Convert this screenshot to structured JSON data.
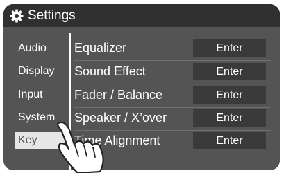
{
  "header": {
    "title": "Settings",
    "icon": "gear-icon"
  },
  "sidebar": {
    "items": [
      {
        "label": "Audio"
      },
      {
        "label": "Display"
      },
      {
        "label": "Input"
      },
      {
        "label": "System"
      },
      {
        "label": "Key",
        "selected": true
      }
    ]
  },
  "rows": [
    {
      "label": "Equalizer",
      "button": "Enter"
    },
    {
      "label": "Sound Effect",
      "button": "Enter"
    },
    {
      "label": "Fader / Balance",
      "button": "Enter"
    },
    {
      "label": "Speaker / X’over",
      "button": "Enter"
    },
    {
      "label": "Time Alignment",
      "button": "Enter"
    }
  ],
  "colors": {
    "panel": "#545454",
    "titlebar": "#303030",
    "button": "#3a3a3a",
    "selected_item": "#e6e6e6",
    "text": "#ffffff"
  }
}
